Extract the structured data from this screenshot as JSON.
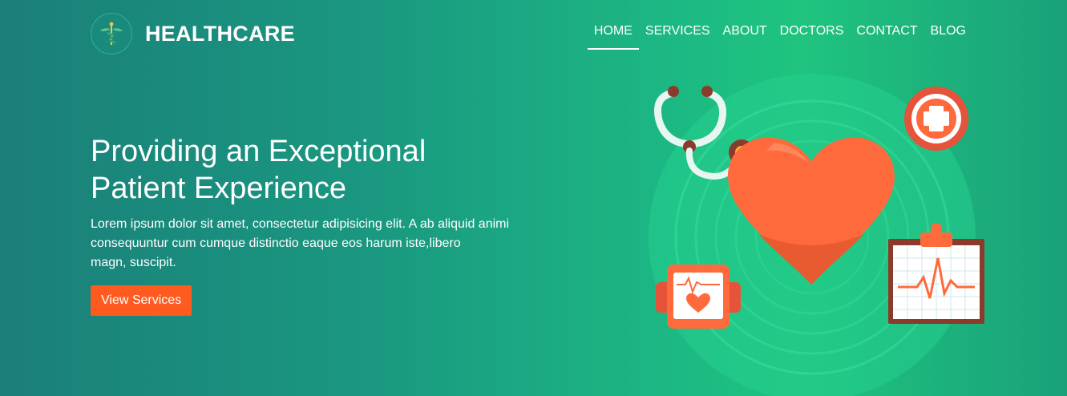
{
  "brand": {
    "name": "HEALTHCARE",
    "logo_icon": "caduceus-icon"
  },
  "nav": {
    "items": [
      {
        "label": "HOME",
        "active": true
      },
      {
        "label": "SERVICES",
        "active": false
      },
      {
        "label": "ABOUT",
        "active": false
      },
      {
        "label": "DOCTORS",
        "active": false
      },
      {
        "label": "CONTACT",
        "active": false
      },
      {
        "label": "BLOG",
        "active": false
      }
    ]
  },
  "hero": {
    "headline_lines": [
      "Providing an Exceptional",
      "Patient Experience"
    ],
    "description_lines": [
      "Lorem ipsum dolor sit amet, consectetur adipisicing elit. A ab aliquid animi",
      "consequuntur cum cumque distinctio eaque eos harum iste,libero",
      "magn, suscipit."
    ],
    "cta_label": "View Services"
  },
  "colors": {
    "accent": "#ff5a1f",
    "heart": "#ff6a3d",
    "background_start": "#1b7f7a",
    "background_end": "#1fc47e"
  },
  "illustration": {
    "icons": [
      "stethoscope-icon",
      "heart-icon",
      "medical-cross-icon",
      "heart-rate-monitor-icon",
      "ecg-clipboard-icon"
    ]
  }
}
